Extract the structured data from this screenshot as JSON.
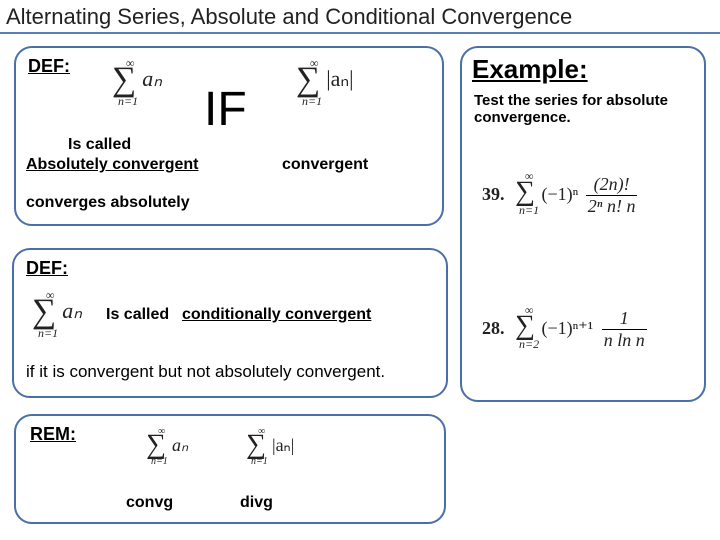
{
  "title": "Alternating Series, Absolute and Conditional Convergence",
  "box1": {
    "def": "DEF:",
    "bigIf": "IF",
    "isCalled": "Is called",
    "absConv": "Absolutely convergent",
    "convergent": "convergent",
    "convergesAbs": "converges absolutely",
    "sum1_top": "∞",
    "sum1_bot": "n=1",
    "sum1_body": "aₙ",
    "sum2_top": "∞",
    "sum2_bot": "n=1",
    "sum2_body": "|aₙ|"
  },
  "box2": {
    "def": "DEF:",
    "isCalled": "Is called",
    "condConv": "conditionally convergent",
    "ifStmt": "if it is convergent but not absolutely convergent.",
    "sum_top": "∞",
    "sum_bot": "n=1",
    "sum_body": "aₙ"
  },
  "box3": {
    "rem": "REM:",
    "convg": "convg",
    "divg": "divg",
    "sum1_top": "∞",
    "sum1_bot": "n=1",
    "sum1_body": "aₙ",
    "sum2_top": "∞",
    "sum2_bot": "n=1",
    "sum2_body": "|aₙ|"
  },
  "box4": {
    "example": "Example:",
    "instr": "Test the series for absolute convergence.",
    "p39": {
      "num": "39.",
      "sum_top": "∞",
      "sum_bot": "n=1",
      "sign": "(−1)ⁿ",
      "frac_n": "(2n)!",
      "frac_d": "2ⁿ n! n"
    },
    "p28": {
      "num": "28.",
      "sum_top": "∞",
      "sum_bot": "n=2",
      "sign": "(−1)ⁿ⁺¹",
      "frac_n": "1",
      "frac_d": "n ln n"
    }
  }
}
